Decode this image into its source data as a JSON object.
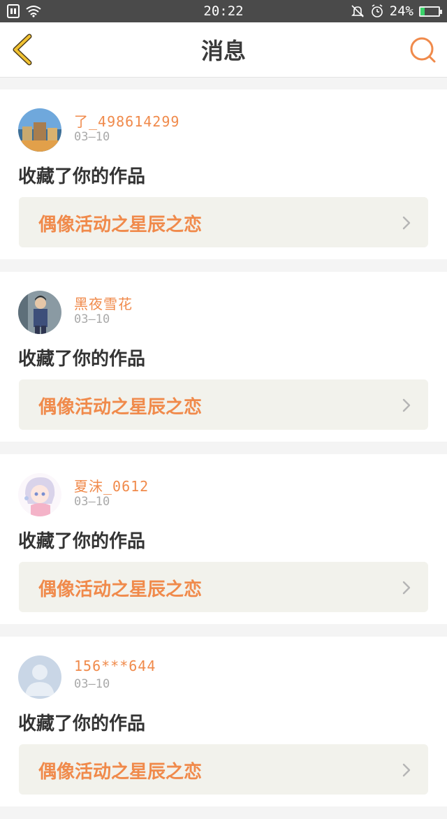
{
  "status_bar": {
    "time": "20:22",
    "battery": "24%",
    "battery_level": 0.24,
    "icons": [
      "sim-icon",
      "wifi-icon",
      "mute-icon",
      "alarm-icon",
      "battery-icon"
    ]
  },
  "header": {
    "title": "消息",
    "back_icon": "chevron-left-icon",
    "search_icon": "search-icon",
    "accent_color": "#f08a4b",
    "back_color": "#f1c232"
  },
  "notifications": [
    {
      "username": "了_498614299",
      "date": "03—10",
      "action": "收藏了你的作品",
      "work_title": "偶像活动之星辰之恋",
      "avatar": "landscape-avatar"
    },
    {
      "username": "黑夜雪花",
      "date": "03—10",
      "action": "收藏了你的作品",
      "work_title": "偶像活动之星辰之恋",
      "avatar": "person-avatar"
    },
    {
      "username": "夏沫_0612",
      "date": "03—10",
      "action": "收藏了你的作品",
      "work_title": "偶像活动之星辰之恋",
      "avatar": "anime-avatar"
    },
    {
      "username": "156***644",
      "date": "03—10",
      "action": "收藏了你的作品",
      "work_title": "偶像活动之星辰之恋",
      "avatar": "default-avatar"
    }
  ]
}
